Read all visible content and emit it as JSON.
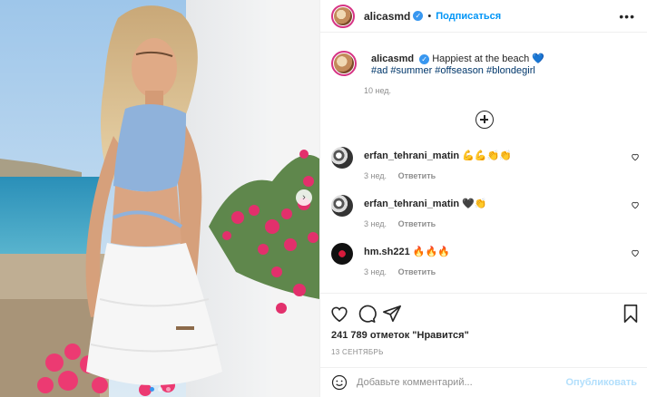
{
  "post": {
    "username": "alicasmd",
    "dot": "•",
    "follow_label": "Подписаться",
    "more": "•••",
    "caption_text": "Happiest at the beach 💙",
    "hashtags": "#ad #summer #offseason #blondegirl",
    "caption_time": "10 нед.",
    "likes": "241 789 отметок \"Нравится\"",
    "date": "13 СЕНТЯБРЬ"
  },
  "comments": [
    {
      "username": "erfan_tehrani_matin",
      "text": "💪💪👏👏",
      "time": "3 нед.",
      "reply": "Ответить"
    },
    {
      "username": "erfan_tehrani_matin",
      "text": "🖤👏",
      "time": "3 нед.",
      "reply": "Ответить"
    },
    {
      "username": "hm.sh221",
      "text": "🔥🔥🔥",
      "time": "3 нед.",
      "reply": "Ответить"
    }
  ],
  "add_comment": {
    "placeholder": "Добавьте комментарий...",
    "post_label": "Опубликовать"
  },
  "icons": {
    "like": "heart-icon",
    "comment": "comment-icon",
    "share": "paper-plane-icon",
    "save": "bookmark-icon",
    "emoji": "smiley-icon",
    "load_more": "plus-circle-icon",
    "next": "chevron-right-icon"
  },
  "colors": {
    "follow": "#0095f6",
    "hashtag": "#00376b",
    "muted": "#8e8e8e",
    "post_disabled": "#b2dffc",
    "verified": "#3897f0"
  },
  "carousel": {
    "slides": 3,
    "active": 1
  }
}
